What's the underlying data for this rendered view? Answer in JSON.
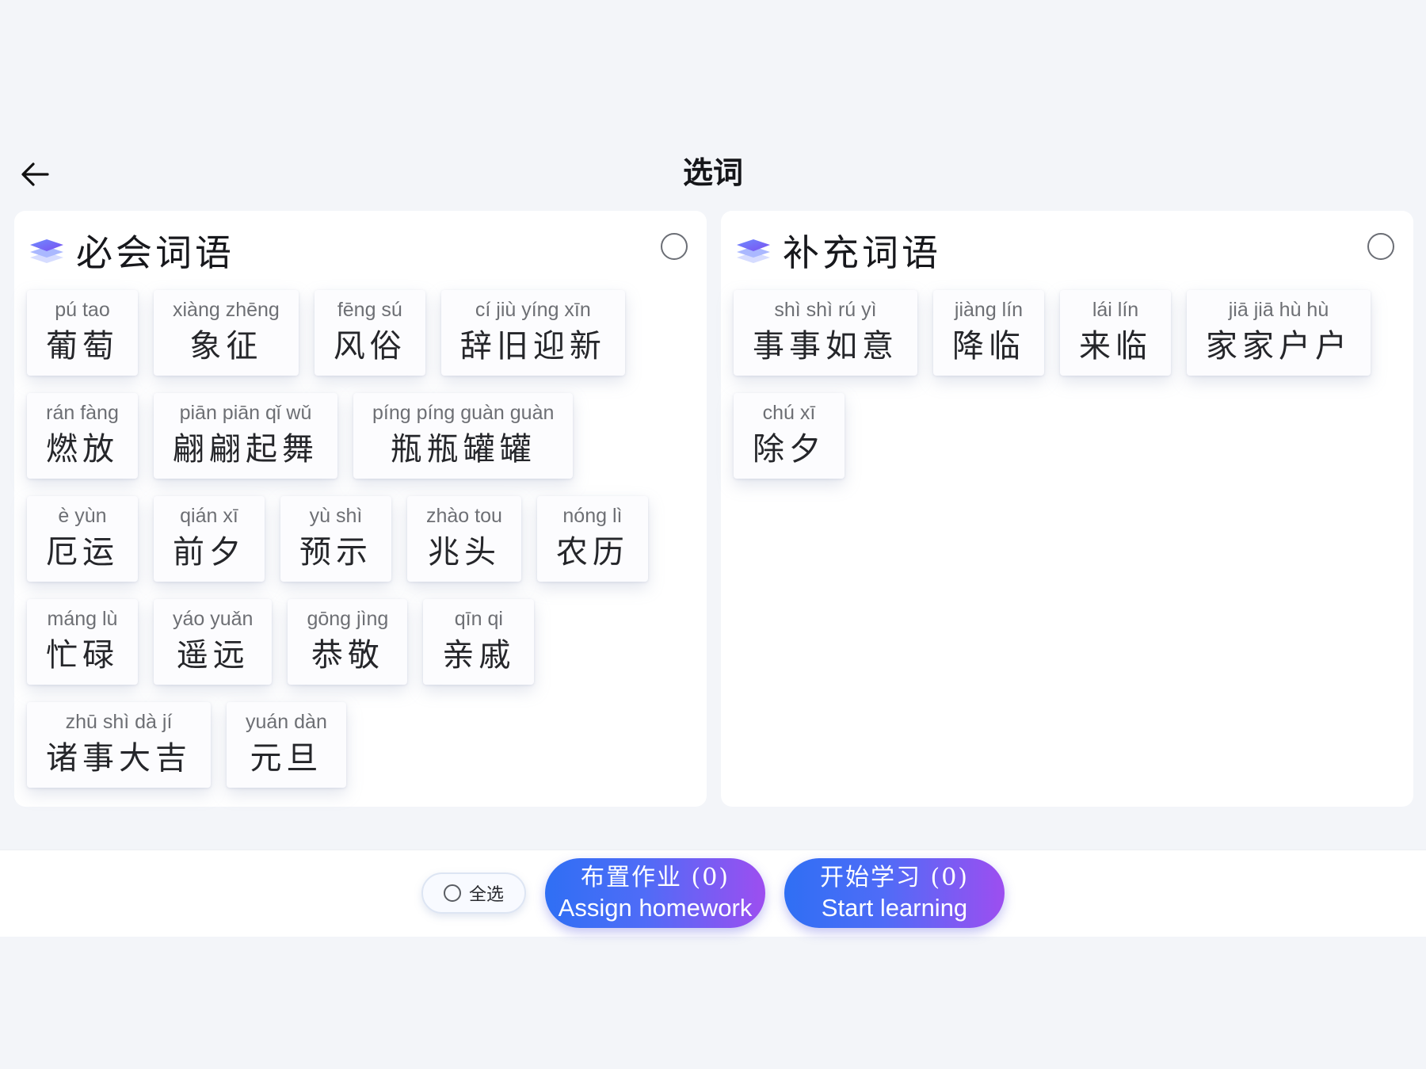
{
  "header": {
    "title": "选词"
  },
  "panels": {
    "required": {
      "title": "必会词语",
      "rows": [
        [
          {
            "pinyin": "pú tao",
            "word": "葡萄"
          },
          {
            "pinyin": "xiàng zhēng",
            "word": "象征"
          },
          {
            "pinyin": "fēng sú",
            "word": "风俗"
          },
          {
            "pinyin": "cí jiù yíng xīn",
            "word": "辞旧迎新"
          }
        ],
        [
          {
            "pinyin": "rán fàng",
            "word": "燃放"
          },
          {
            "pinyin": "piān piān qǐ wǔ",
            "word": "翩翩起舞"
          },
          {
            "pinyin": "píng píng guàn guàn",
            "word": "瓶瓶罐罐"
          }
        ],
        [
          {
            "pinyin": "è yùn",
            "word": "厄运"
          },
          {
            "pinyin": "qián xī",
            "word": "前夕"
          },
          {
            "pinyin": "yù shì",
            "word": "预示"
          },
          {
            "pinyin": "zhào tou",
            "word": "兆头"
          },
          {
            "pinyin": "nóng lì",
            "word": "农历"
          }
        ],
        [
          {
            "pinyin": "máng lù",
            "word": "忙碌"
          },
          {
            "pinyin": "yáo yuǎn",
            "word": "遥远"
          },
          {
            "pinyin": "gōng jìng",
            "word": "恭敬"
          },
          {
            "pinyin": "qīn qi",
            "word": "亲戚"
          }
        ],
        [
          {
            "pinyin": "zhū shì dà jí",
            "word": "诸事大吉"
          },
          {
            "pinyin": "yuán dàn",
            "word": "元旦"
          }
        ]
      ]
    },
    "supplementary": {
      "title": "补充词语",
      "rows": [
        [
          {
            "pinyin": "shì shì rú yì",
            "word": "事事如意"
          },
          {
            "pinyin": "jiàng lín",
            "word": "降临"
          },
          {
            "pinyin": "lái lín",
            "word": "来临"
          },
          {
            "pinyin": "jiā jiā hù hù",
            "word": "家家户户"
          }
        ],
        [
          {
            "pinyin": "chú xī",
            "word": "除夕"
          }
        ]
      ]
    }
  },
  "footer": {
    "select_all": "全选",
    "assign": {
      "zh": "布置作业 (0)",
      "en": "Assign homework"
    },
    "start": {
      "zh": "开始学习 (0)",
      "en": "Start learning"
    }
  },
  "colors": {
    "accent_start": "#2f6ff4",
    "accent_end": "#9d4ef0",
    "icon": "#4f63e8"
  },
  "icons": {
    "back": "arrow-left-icon",
    "panel": "layers-icon"
  }
}
